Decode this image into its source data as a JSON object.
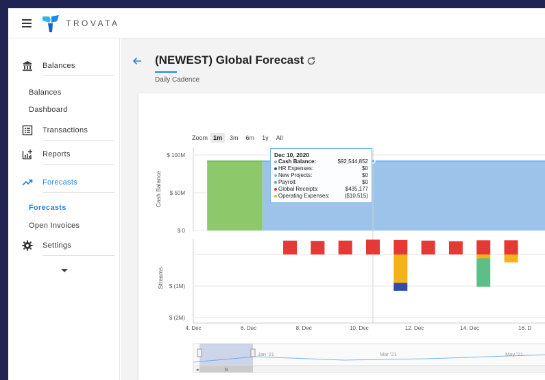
{
  "app": {
    "brand": "TROVATA"
  },
  "sidebar": {
    "balances": "Balances",
    "balances_sub": [
      "Balances",
      "Dashboard"
    ],
    "transactions": "Transactions",
    "reports": "Reports",
    "forecasts": "Forecasts",
    "forecasts_sub": [
      "Forecasts",
      "Open Invoices"
    ],
    "settings": "Settings"
  },
  "page": {
    "title": "(NEWEST) Global Forecast",
    "subtitle": "Daily Cadence"
  },
  "zoom": {
    "label": "Zoom",
    "options": [
      "1m",
      "3m",
      "6m",
      "1y",
      "All"
    ],
    "selected": "1m"
  },
  "tooltip": {
    "date": "Dec 10, 2020",
    "rows": [
      {
        "label": "Cash Balance:",
        "value": "$92,544,852",
        "color": "#7cb5ec",
        "bold": true
      },
      {
        "label": "HR Expenses:",
        "value": "$0",
        "color": "#2d4fa8"
      },
      {
        "label": "New Projects:",
        "value": "$0",
        "color": "#7cb5ec"
      },
      {
        "label": "Payroll:",
        "value": "$0",
        "color": "#5bbf87"
      },
      {
        "label": "Global Receipts:",
        "value": "$435,177",
        "color": "#e53935"
      },
      {
        "label": "Operating Expenses:",
        "value": "($10,515)",
        "color": "#f5b21b"
      }
    ]
  },
  "chart_data": [
    {
      "type": "area",
      "ylabel": "Cash Balance",
      "yticks": [
        "$ 100M",
        "$ 50M",
        "$ 0"
      ],
      "ylim": [
        0,
        110
      ],
      "x": [
        4,
        17
      ],
      "series": [
        {
          "values": [
            [
              4.5,
              92
            ],
            [
              6.5,
              92
            ]
          ],
          "color": "#8cc96a"
        },
        {
          "values": [
            [
              6.5,
              92
            ],
            [
              17,
              92
            ]
          ],
          "color": "#9cc4ea"
        }
      ]
    },
    {
      "type": "bar",
      "ylabel": "Streams",
      "yticks": [
        "$ (1M)",
        "$ (2M)"
      ],
      "ylim": [
        -2,
        0.5
      ],
      "xticks": [
        "4. Dec",
        "6. Dec",
        "8. Dec",
        "10. Dec",
        "12. Dec",
        "14. Dec",
        "16. D"
      ],
      "series": [
        {
          "name": "Global Receipts",
          "color": "#e53935",
          "values": [
            [
              7.5,
              0.44
            ],
            [
              8.5,
              0.43
            ],
            [
              9.5,
              0.44
            ],
            [
              10.5,
              0.47
            ],
            [
              11.5,
              0.46
            ],
            [
              12.5,
              0.44
            ],
            [
              13.5,
              0.42
            ],
            [
              14.5,
              0.45
            ],
            [
              15.5,
              0.45
            ]
          ]
        },
        {
          "name": "Operating Expenses",
          "color": "#f5b21b",
          "values": [
            [
              11.5,
              -0.9
            ],
            [
              14.5,
              -0.12
            ],
            [
              15.5,
              -0.25
            ]
          ]
        },
        {
          "name": "HR Expenses",
          "color": "#2d4fa8",
          "values": [
            [
              11.5,
              -0.25
            ]
          ]
        },
        {
          "name": "Payroll",
          "color": "#5bbf87",
          "values": [
            [
              14.5,
              -0.9
            ]
          ]
        }
      ]
    }
  ],
  "navigator": {
    "labels": [
      "Jan '21",
      "Mar '21",
      "May '21"
    ],
    "scrollbar_glyph": "III"
  }
}
